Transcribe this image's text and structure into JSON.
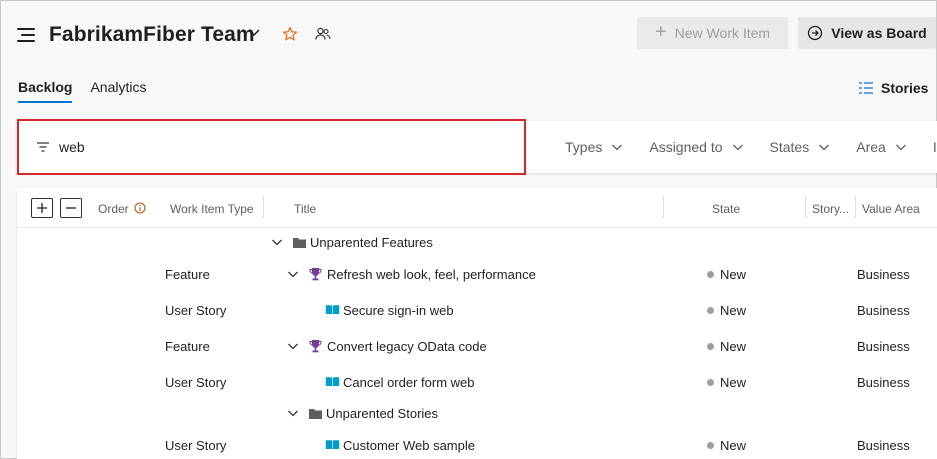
{
  "header": {
    "team_name": "FabrikamFiber Team",
    "new_work_item_label": "New Work Item",
    "view_as_board_label": "View as Board"
  },
  "tabs": [
    {
      "label": "Backlog",
      "active": true
    },
    {
      "label": "Analytics",
      "active": false
    }
  ],
  "level_selector": {
    "label": "Stories"
  },
  "filter": {
    "keyword": "web",
    "pickers": [
      "Types",
      "Assigned to",
      "States",
      "Area",
      "It"
    ]
  },
  "grid": {
    "columns": {
      "order": "Order",
      "work_item_type": "Work Item Type",
      "title": "Title",
      "state": "State",
      "story_points": "Story...",
      "value_area": "Value Area"
    },
    "rows": [
      {
        "kind": "group",
        "title": "Unparented Features"
      },
      {
        "kind": "item",
        "type": "Feature",
        "icon": "trophy-icon",
        "expandable": true,
        "title": "Refresh web look, feel, performance",
        "state": "New",
        "value_area": "Business"
      },
      {
        "kind": "item",
        "type": "User Story",
        "icon": "book-icon",
        "expandable": false,
        "title": "Secure sign-in web",
        "state": "New",
        "value_area": "Business"
      },
      {
        "kind": "item",
        "type": "Feature",
        "icon": "trophy-icon",
        "expandable": true,
        "title": "Convert legacy OData code",
        "state": "New",
        "value_area": "Business"
      },
      {
        "kind": "item",
        "type": "User Story",
        "icon": "book-icon",
        "expandable": false,
        "title": "Cancel order form web",
        "state": "New",
        "value_area": "Business"
      },
      {
        "kind": "group",
        "title": "Unparented Stories"
      },
      {
        "kind": "item",
        "type": "User Story",
        "icon": "book-icon",
        "expandable": false,
        "title": "Customer Web sample",
        "state": "New",
        "value_area": "Business"
      }
    ]
  },
  "colors": {
    "accent": "#0078d4",
    "feature_icon": "#773b93",
    "story_icon": "#009ccc",
    "filter_highlight": "#d9262c",
    "state_new": "#a19f9d"
  }
}
